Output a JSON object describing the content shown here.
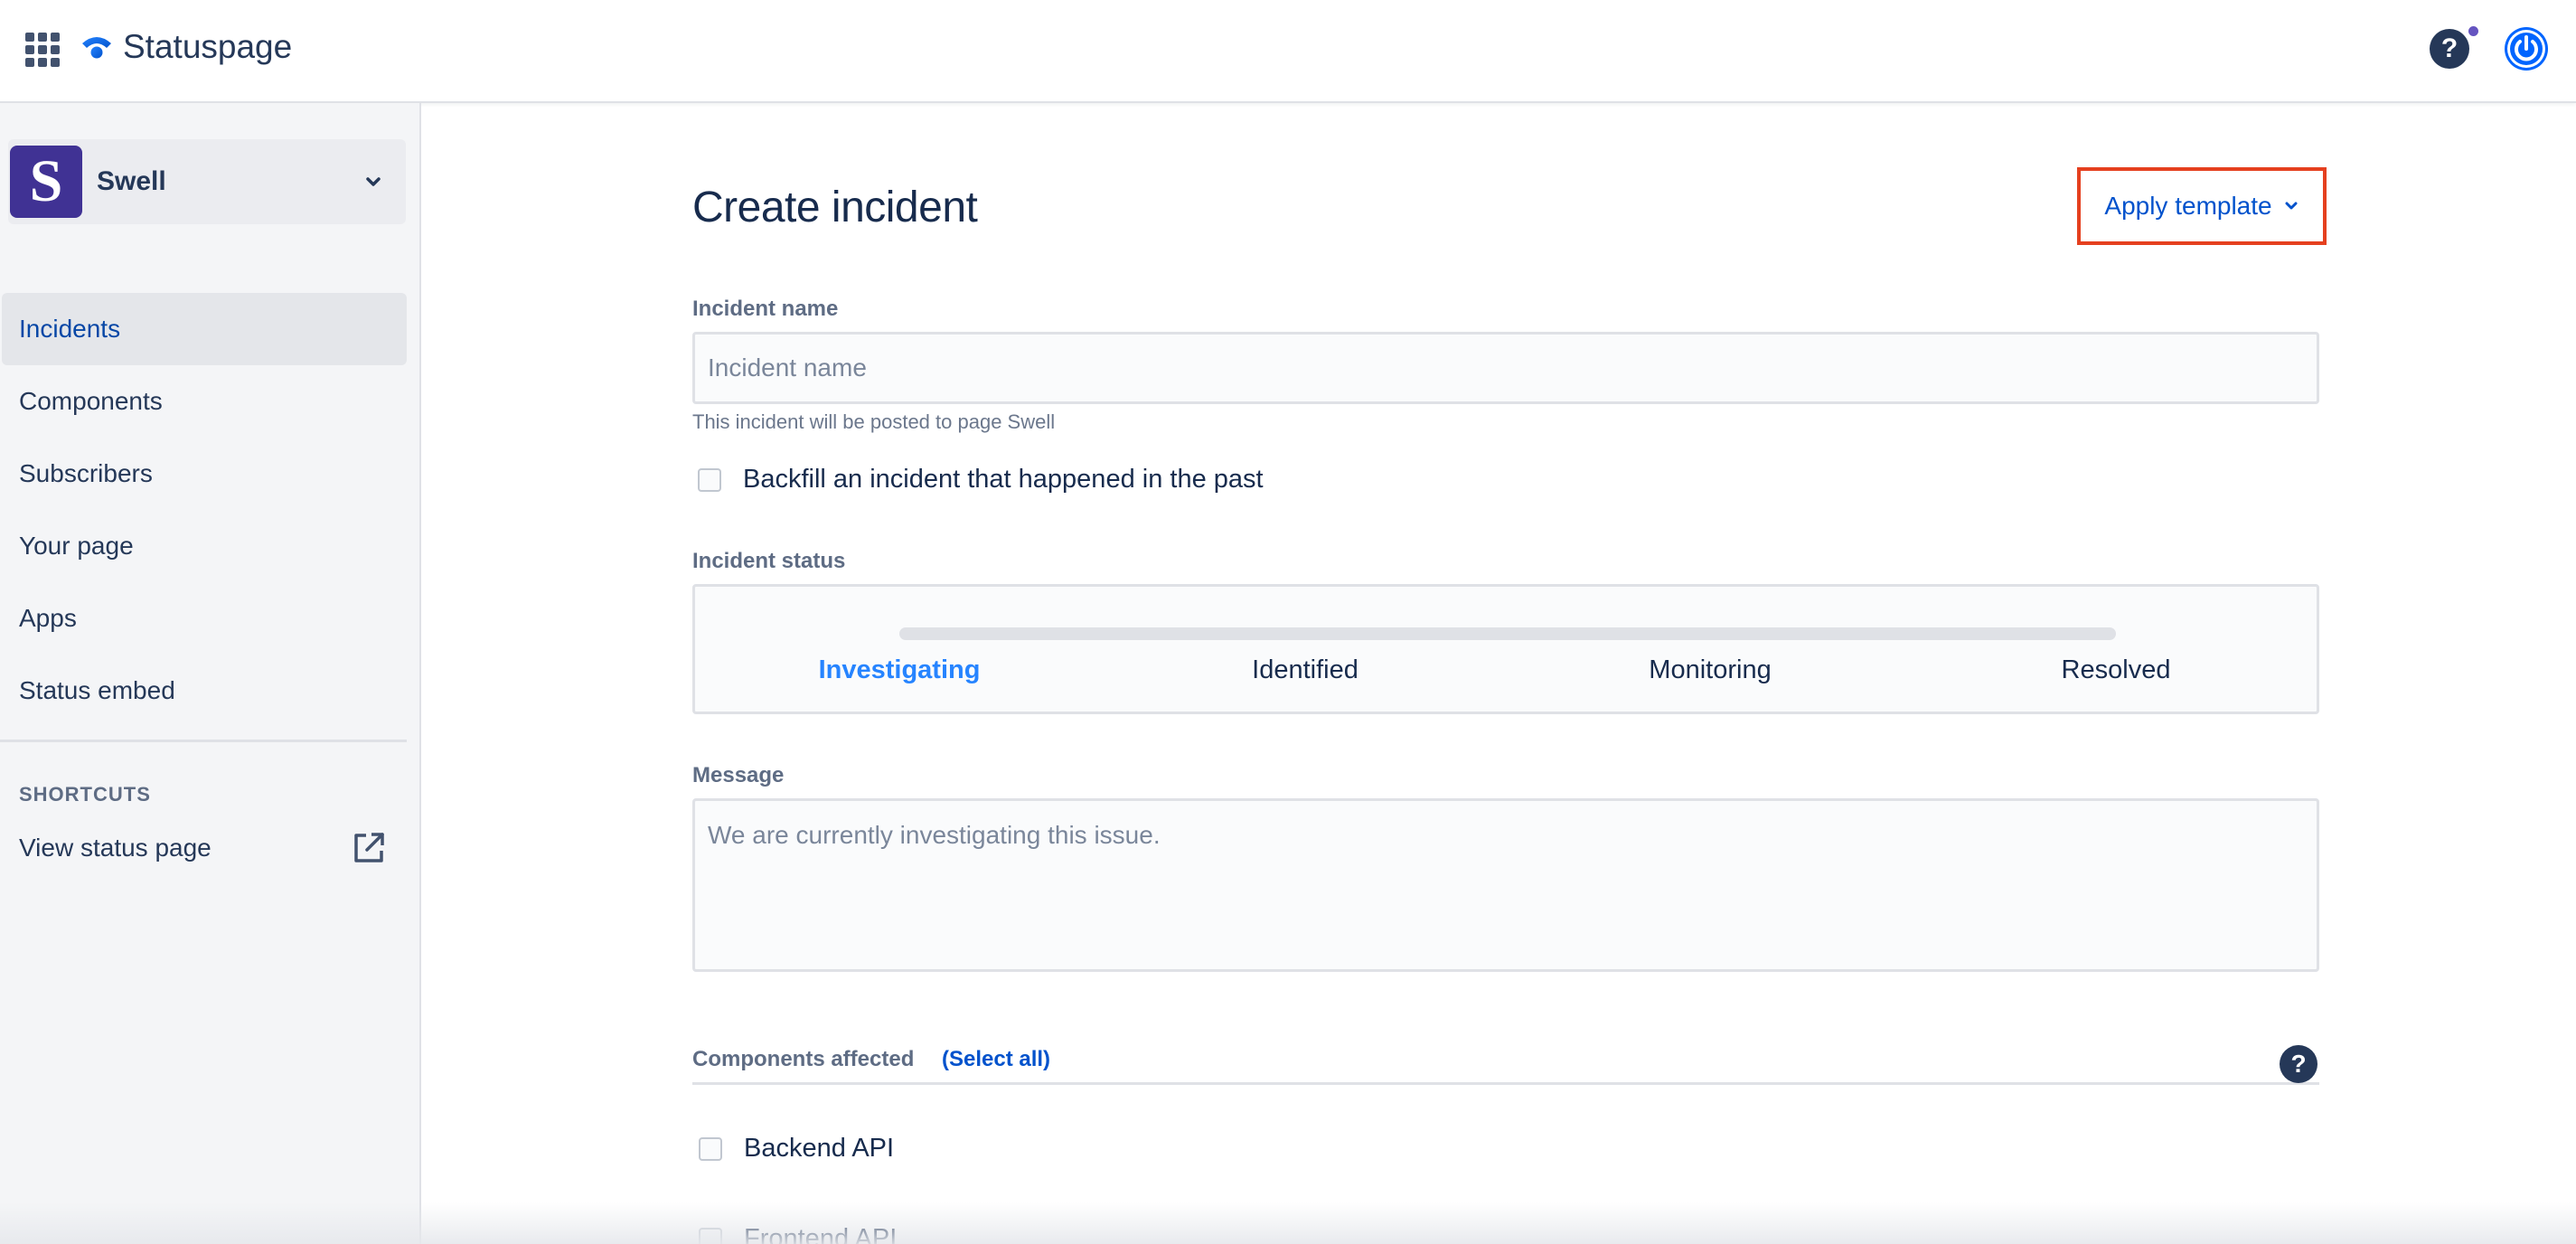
{
  "app": {
    "name": "Statuspage"
  },
  "header": {
    "help_icon": "question-icon",
    "account_icon": "power-icon",
    "apps_icon": "app-grid-icon"
  },
  "sidebar": {
    "page": {
      "initial": "S",
      "name": "Swell",
      "avatar_color": "#403294"
    },
    "items": [
      {
        "label": "Incidents",
        "active": true
      },
      {
        "label": "Components"
      },
      {
        "label": "Subscribers"
      },
      {
        "label": "Your page"
      },
      {
        "label": "Apps"
      },
      {
        "label": "Status embed"
      }
    ],
    "shortcuts_label": "SHORTCUTS",
    "shortcut": {
      "label": "View status page",
      "icon": "external-link-icon"
    }
  },
  "main": {
    "title": "Create incident",
    "apply_template": {
      "label": "Apply template",
      "highlight_color": "#e5401f"
    },
    "incident_name": {
      "label": "Incident name",
      "placeholder": "Incident name",
      "value": "",
      "helper": "This incident will be posted to page Swell"
    },
    "backfill": {
      "label": "Backfill an incident that happened in the past",
      "checked": false
    },
    "status": {
      "label": "Incident status",
      "steps": [
        "Investigating",
        "Identified",
        "Monitoring",
        "Resolved"
      ],
      "selected": "Investigating"
    },
    "message": {
      "label": "Message",
      "placeholder": "We are currently investigating this issue.",
      "value": ""
    },
    "components": {
      "label": "Components affected",
      "select_all": "(Select all)",
      "items": [
        {
          "label": "Backend API",
          "checked": false
        },
        {
          "label": "Frontend API",
          "checked": false
        }
      ]
    }
  },
  "colors": {
    "accent": "#0052cc",
    "active_status": "#2684ff",
    "text": "#172b4d"
  }
}
